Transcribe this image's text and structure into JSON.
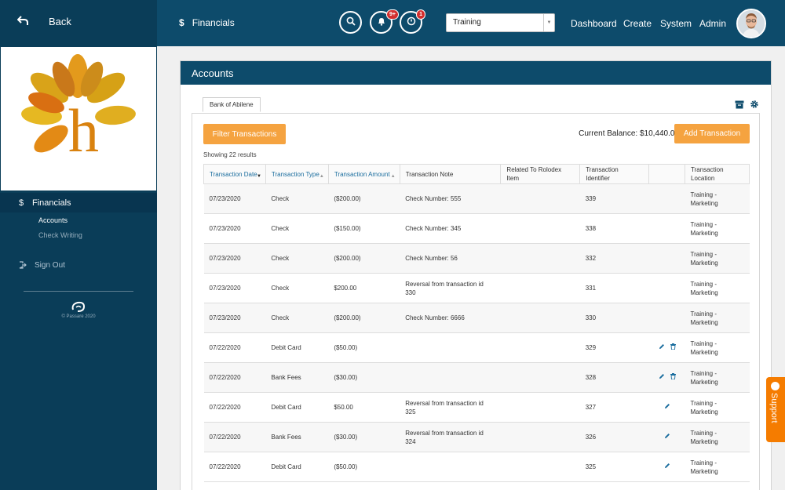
{
  "header": {
    "back_label": "Back",
    "breadcrumb_symbol": "$",
    "breadcrumb_title": "Financials",
    "notifications_badge": "9+",
    "alerts_badge": "1",
    "environment_select": "Training",
    "nav": [
      "Dashboard",
      "Create",
      "System",
      "Admin"
    ]
  },
  "sidebar": {
    "section_symbol": "$",
    "section_label": "Financials",
    "items": [
      "Accounts",
      "Check Writing"
    ],
    "sign_out": "Sign Out",
    "copyright": "© Passare 2020"
  },
  "panel": {
    "title": "Accounts",
    "account_tab": "Bank of Abilene",
    "filter_button": "Filter Transactions",
    "current_balance": "Current Balance: $10,440.00",
    "add_button": "Add Transaction",
    "results_text": "Showing 22 results"
  },
  "table": {
    "headers": [
      "Transaction Date",
      "Transaction Type",
      "Transaction Amount",
      "Transaction Note",
      "Related To Rolodex Item",
      "Transaction Identifier",
      "",
      "Transaction Location"
    ],
    "rows": [
      {
        "date": "07/23/2020",
        "type": "Check",
        "amount": "($200.00)",
        "note": "Check Number: 555",
        "rolodex": "",
        "id": "339",
        "actions": "none",
        "location": "Training - Marketing"
      },
      {
        "date": "07/23/2020",
        "type": "Check",
        "amount": "($150.00)",
        "note": "Check Number: 345",
        "rolodex": "",
        "id": "338",
        "actions": "none",
        "location": "Training - Marketing"
      },
      {
        "date": "07/23/2020",
        "type": "Check",
        "amount": "($200.00)",
        "note": "Check Number: 56",
        "rolodex": "",
        "id": "332",
        "actions": "none",
        "location": "Training - Marketing"
      },
      {
        "date": "07/23/2020",
        "type": "Check",
        "amount": "$200.00",
        "note": "Reversal from transaction id 330",
        "rolodex": "",
        "id": "331",
        "actions": "none",
        "location": "Training - Marketing"
      },
      {
        "date": "07/23/2020",
        "type": "Check",
        "amount": "($200.00)",
        "note": "Check Number: 6666",
        "rolodex": "",
        "id": "330",
        "actions": "none",
        "location": "Training - Marketing"
      },
      {
        "date": "07/22/2020",
        "type": "Debit Card",
        "amount": "($50.00)",
        "note": "",
        "rolodex": "",
        "id": "329",
        "actions": "edit-delete",
        "location": "Training - Marketing"
      },
      {
        "date": "07/22/2020",
        "type": "Bank Fees",
        "amount": "($30.00)",
        "note": "",
        "rolodex": "",
        "id": "328",
        "actions": "edit-delete",
        "location": "Training - Marketing"
      },
      {
        "date": "07/22/2020",
        "type": "Debit Card",
        "amount": "$50.00",
        "note": "Reversal from transaction id 325",
        "rolodex": "",
        "id": "327",
        "actions": "edit",
        "location": "Training - Marketing"
      },
      {
        "date": "07/22/2020",
        "type": "Bank Fees",
        "amount": "($30.00)",
        "note": "Reversal from transaction id 324",
        "rolodex": "",
        "id": "326",
        "actions": "edit",
        "location": "Training - Marketing"
      },
      {
        "date": "07/22/2020",
        "type": "Debit Card",
        "amount": "($50.00)",
        "note": "",
        "rolodex": "",
        "id": "325",
        "actions": "edit",
        "location": "Training - Marketing"
      }
    ]
  },
  "support_label": "Support",
  "colors": {
    "header": "#0d4b6b",
    "sidebar": "#0a3d58",
    "accent_orange": "#f5a340",
    "support_orange": "#f57c00",
    "link_blue": "#1a6d9e",
    "badge_red": "#d32f2f"
  },
  "icons": {
    "back": "back-arrow-icon",
    "search": "search-icon",
    "notifications": "bell-icon",
    "alerts": "clock-icon",
    "archive": "archive-icon",
    "settings": "gear-icon",
    "edit": "pencil-icon",
    "delete": "trash-icon",
    "sign_out": "sign-out-icon",
    "support": "support-icon"
  }
}
